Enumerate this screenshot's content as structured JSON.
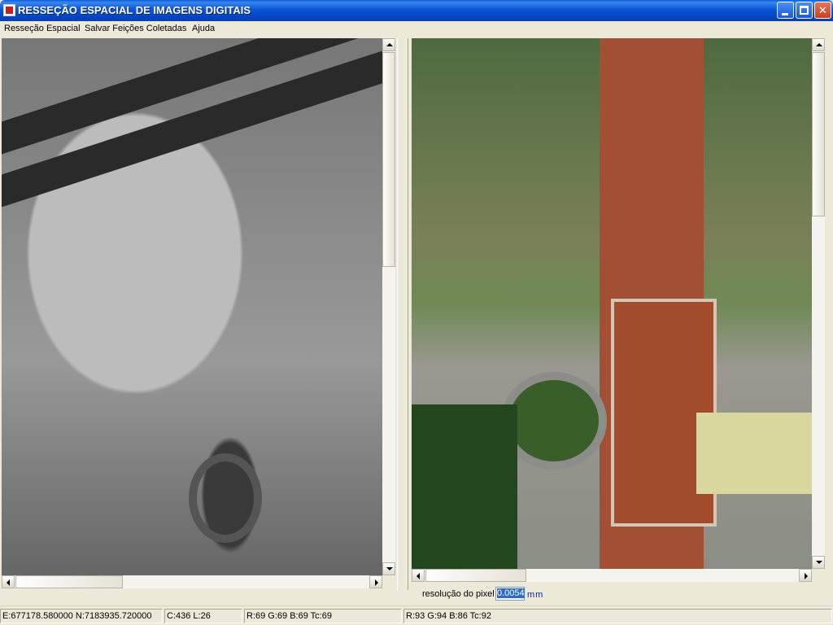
{
  "window": {
    "title": "RESSEÇÃO ESPACIAL DE IMAGENS DIGITAIS"
  },
  "menu": {
    "items": [
      "Resseção Espacial",
      "Salvar Feições Coletadas",
      "Ajuda"
    ]
  },
  "views": {
    "left_image": "grayscale aerial image",
    "right_image": "color aerial image"
  },
  "resolution": {
    "label": "resolução do pixel",
    "value": "0.0054",
    "unit": "mm"
  },
  "status": {
    "coords": "E:677178.580000  N:7183935.720000",
    "cursor": "C:436  L:26",
    "left_pixel": "R:69  G:69  B:69  Tc:69",
    "right_pixel": "R:93  G:94  B:86  Tc:92"
  },
  "colors": {
    "titlebar": "#0a55d6",
    "selection": "#316ac5",
    "unit_text": "#0a25b4"
  }
}
